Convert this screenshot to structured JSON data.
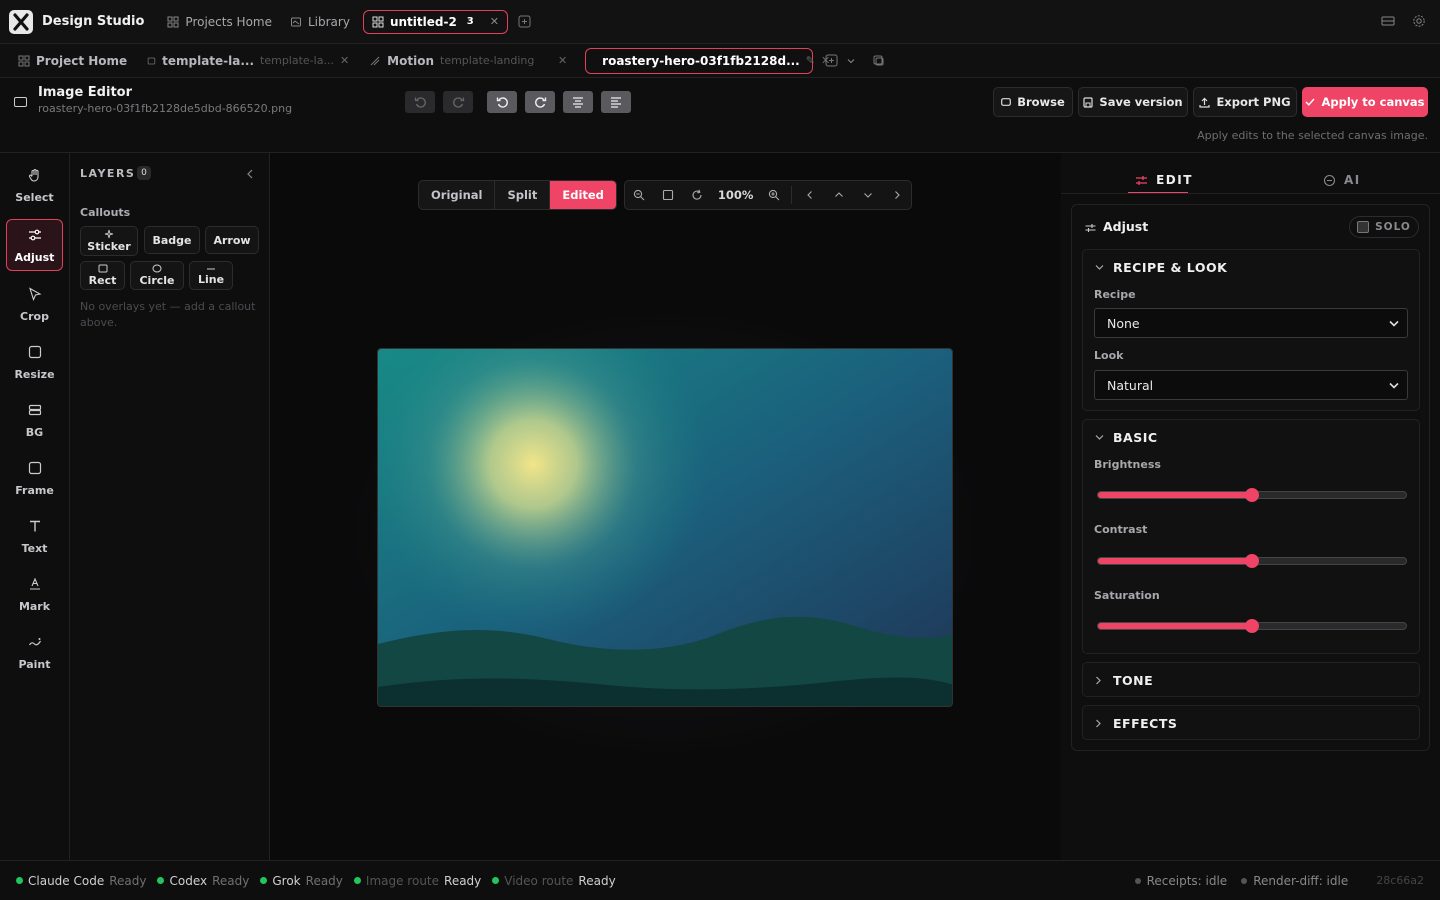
{
  "app": {
    "title": "Design Studio"
  },
  "topnav": {
    "projects_home": "Projects Home",
    "library": "Library",
    "project_tab": "untitled-2",
    "project_count": "3"
  },
  "tabs": [
    {
      "label": "Project Home",
      "sub": ""
    },
    {
      "label": "template-la...",
      "sub": "template-la..."
    },
    {
      "label": "Motion",
      "sub": "template-landing"
    },
    {
      "label": "roastery-hero-03f1fb2128d...",
      "sub": ""
    }
  ],
  "header": {
    "title": "Image Editor",
    "filename": "roastery-hero-03f1fb2128de5dbd-866520.png",
    "browse": "Browse",
    "save_version": "Save version",
    "export_png": "Export PNG",
    "apply": "Apply to canvas",
    "apply_hint": "Apply edits to the selected canvas image."
  },
  "tools": [
    "Select",
    "Adjust",
    "Crop",
    "Resize",
    "BG",
    "Frame",
    "Text",
    "Mark",
    "Paint"
  ],
  "active_tool": "Adjust",
  "layers": {
    "title": "LAYERS",
    "count": "0",
    "callouts_label": "Callouts",
    "callouts": [
      "Sticker",
      "Badge",
      "Arrow",
      "Rect",
      "Circle",
      "Line"
    ],
    "empty": "No overlays yet — add a callout above."
  },
  "view": {
    "modes": [
      "Original",
      "Split",
      "Edited"
    ],
    "active": "Edited",
    "zoom": "100%"
  },
  "panel": {
    "tab_edit": "EDIT",
    "tab_ai": "AI",
    "adjust_title": "Adjust",
    "solo": "SOLO",
    "recipe_section": "RECIPE & LOOK",
    "recipe_label": "Recipe",
    "recipe_value": "None",
    "look_label": "Look",
    "look_value": "Natural",
    "basic_section": "BASIC",
    "brightness_label": "Brightness",
    "brightness": 0.5,
    "contrast_label": "Contrast",
    "contrast": 0.5,
    "saturation_label": "Saturation",
    "saturation": 0.5,
    "tone_section": "TONE",
    "effects_section": "EFFECTS"
  },
  "status": {
    "items": [
      {
        "name": "Claude Code",
        "state": "Ready"
      },
      {
        "name": "Codex",
        "state": "Ready"
      },
      {
        "name": "Grok",
        "state": "Ready"
      },
      {
        "name": "Image route",
        "state": "Ready"
      },
      {
        "name": "Video route",
        "state": "Ready"
      }
    ],
    "receipts": "Receipts: idle",
    "render_diff": "Render-diff: idle",
    "build": "28c66a2"
  },
  "colors": {
    "accent": "#ef4466",
    "ready": "#22c55e"
  }
}
